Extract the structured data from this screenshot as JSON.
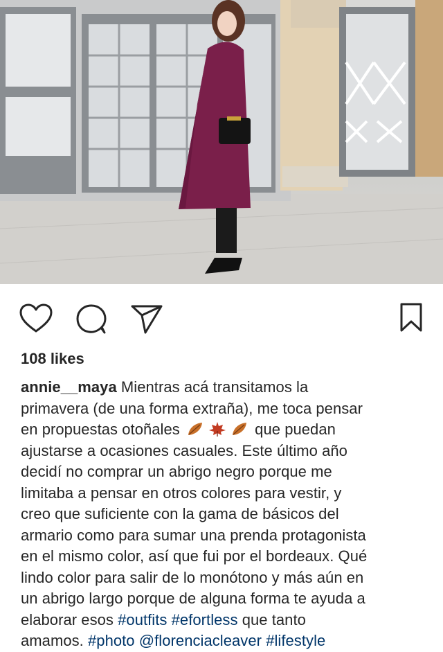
{
  "post": {
    "likes": "108 likes",
    "username": "annie__maya",
    "caption_lines": [
      "Mientras acá transitamos la",
      "primavera (de una forma extraña), me toca pensar",
      "en propuestas otoñales",
      "que puedan",
      "ajustarse a ocasiones casuales. Este último año",
      "decidí no comprar un abrigo negro porque me",
      "limitaba a pensar en otros colores para vestir, y",
      "creo que suficiente con la gama de básicos del",
      "armario como para sumar una prenda protagonista",
      "en el mismo color, así que fui por el bordeaux. Qué",
      "lindo color para salir de lo monótono y más aún en",
      "un abrigo largo porque de alguna forma te ayuda a",
      "elaborar esos",
      "que tanto",
      "amamos."
    ],
    "hashtags": {
      "outfits": "#outfits",
      "efortless": "#efortless",
      "photo": "#photo",
      "mention": "@florenciacleaver",
      "lifestyle": "#lifestyle"
    },
    "emoji_icons": [
      "fallen-leaf-icon",
      "maple-leaf-icon",
      "fallen-leaf-icon"
    ]
  },
  "actions": {
    "icons": [
      "heart-icon",
      "comment-icon",
      "share-icon",
      "bookmark-icon"
    ]
  },
  "colors": {
    "text": "#262626",
    "link": "#003569",
    "coat": "#7a1f4a"
  }
}
